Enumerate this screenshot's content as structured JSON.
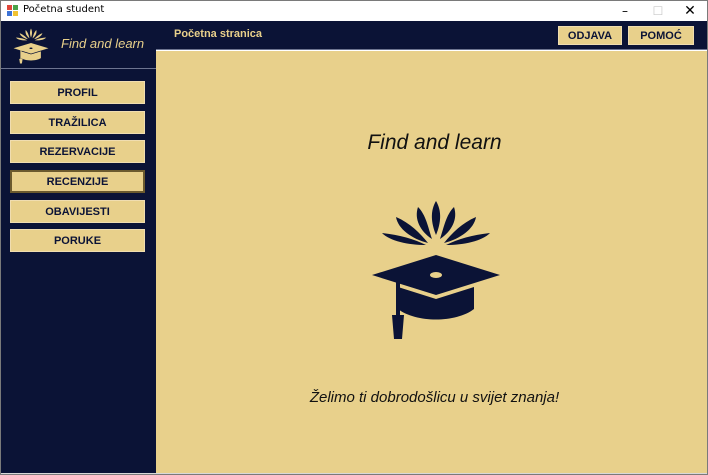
{
  "window": {
    "title": "Početna student",
    "controls": {
      "minimize": "–",
      "maximize": "☐",
      "close": "✕"
    }
  },
  "sidebar": {
    "brand": "Find and learn",
    "logo_icon": "graduation-cap-icon",
    "items": [
      {
        "label": "PROFIL",
        "active": false
      },
      {
        "label": "TRAŽILICA",
        "active": false
      },
      {
        "label": "REZERVACIJE",
        "active": false
      },
      {
        "label": "RECENZIJE",
        "active": true
      },
      {
        "label": "OBAVIJESTI",
        "active": false
      },
      {
        "label": "PORUKE",
        "active": false
      }
    ]
  },
  "topbar": {
    "page_label": "Početna stranica",
    "logout_label": "ODJAVA",
    "help_label": "POMOĆ"
  },
  "main": {
    "title": "Find and learn",
    "logo_icon": "graduation-cap-icon",
    "welcome": "Želimo ti dobrodošlicu u svijet znanja!"
  },
  "colors": {
    "navy": "#0b1336",
    "gold": "#e8d08b"
  }
}
